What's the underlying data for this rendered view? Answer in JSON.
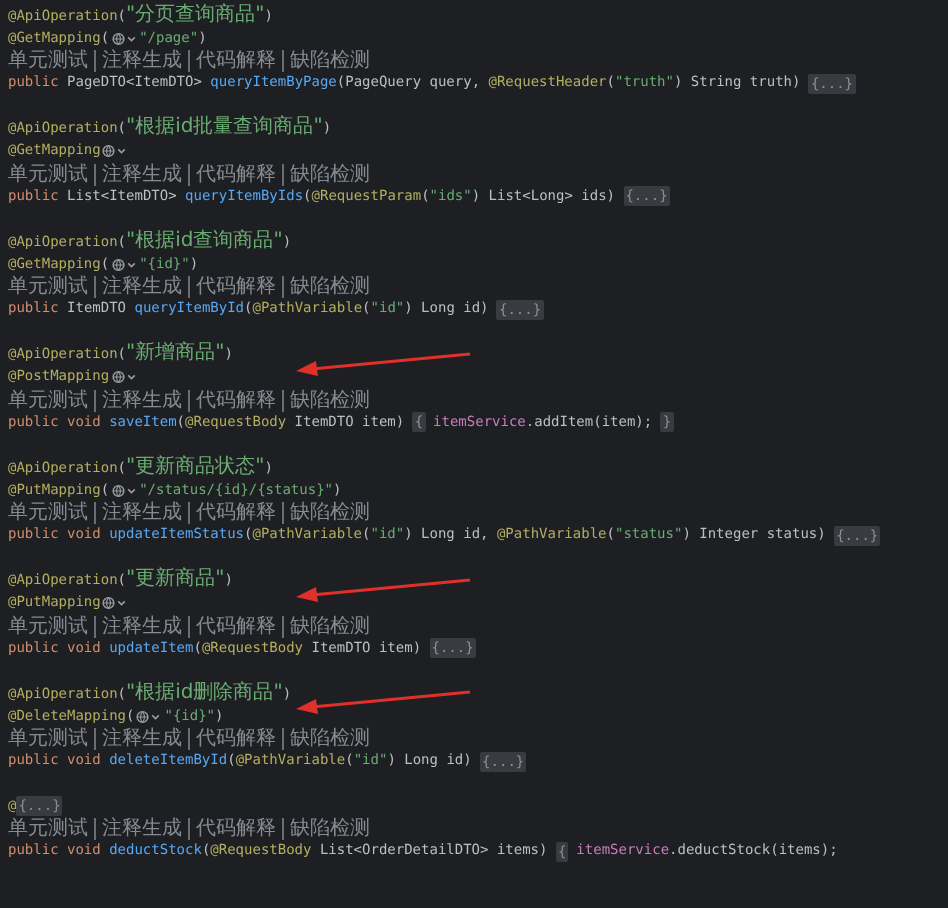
{
  "blocks": [
    {
      "arrow": false,
      "lines": [
        {
          "kind": "code",
          "tokens": [
            {
              "kind": "annotation",
              "text": "@ApiOperation"
            },
            {
              "kind": "plain",
              "text": "("
            },
            {
              "kind": "string",
              "text": "\"分页查询商品\""
            },
            {
              "kind": "plain",
              "text": ")"
            }
          ]
        },
        {
          "kind": "code",
          "tokens": [
            {
              "kind": "annotation",
              "text": "@GetMapping"
            },
            {
              "kind": "plain",
              "text": "("
            },
            {
              "kind": "icon"
            },
            {
              "kind": "string",
              "text": "\"/page\""
            },
            {
              "kind": "plain",
              "text": ")"
            }
          ]
        },
        {
          "kind": "lens",
          "items": [
            "单元测试",
            "注释生成",
            "代码解释",
            "缺陷检测"
          ]
        },
        {
          "kind": "code",
          "tokens": [
            {
              "kind": "keyword",
              "text": "public "
            },
            {
              "kind": "plain",
              "text": "PageDTO<ItemDTO> "
            },
            {
              "kind": "method",
              "text": "queryItemByPage"
            },
            {
              "kind": "plain",
              "text": "(PageQuery query, "
            },
            {
              "kind": "annotation",
              "text": "@RequestHeader"
            },
            {
              "kind": "plain",
              "text": "("
            },
            {
              "kind": "string",
              "text": "\"truth\""
            },
            {
              "kind": "plain",
              "text": ") String truth) "
            },
            {
              "kind": "fold",
              "text": "{...}"
            }
          ]
        }
      ]
    },
    {
      "arrow": false,
      "lines": [
        {
          "kind": "code",
          "tokens": [
            {
              "kind": "annotation",
              "text": "@ApiOperation"
            },
            {
              "kind": "plain",
              "text": "("
            },
            {
              "kind": "string",
              "text": "\"根据id批量查询商品\""
            },
            {
              "kind": "plain",
              "text": ")"
            }
          ]
        },
        {
          "kind": "code",
          "tokens": [
            {
              "kind": "annotation",
              "text": "@GetMapping"
            },
            {
              "kind": "icon"
            }
          ]
        },
        {
          "kind": "lens",
          "items": [
            "单元测试",
            "注释生成",
            "代码解释",
            "缺陷检测"
          ]
        },
        {
          "kind": "code",
          "tokens": [
            {
              "kind": "keyword",
              "text": "public "
            },
            {
              "kind": "plain",
              "text": "List<ItemDTO> "
            },
            {
              "kind": "method",
              "text": "queryItemByIds"
            },
            {
              "kind": "plain",
              "text": "("
            },
            {
              "kind": "annotation",
              "text": "@RequestParam"
            },
            {
              "kind": "plain",
              "text": "("
            },
            {
              "kind": "string",
              "text": "\"ids\""
            },
            {
              "kind": "plain",
              "text": ") List<Long> ids) "
            },
            {
              "kind": "fold",
              "text": "{...}"
            }
          ]
        }
      ]
    },
    {
      "arrow": false,
      "lines": [
        {
          "kind": "code",
          "tokens": [
            {
              "kind": "annotation",
              "text": "@ApiOperation"
            },
            {
              "kind": "plain",
              "text": "("
            },
            {
              "kind": "string",
              "text": "\"根据id查询商品\""
            },
            {
              "kind": "plain",
              "text": ")"
            }
          ]
        },
        {
          "kind": "code",
          "tokens": [
            {
              "kind": "annotation",
              "text": "@GetMapping"
            },
            {
              "kind": "plain",
              "text": "("
            },
            {
              "kind": "icon"
            },
            {
              "kind": "string",
              "text": "\"{id}\""
            },
            {
              "kind": "plain",
              "text": ")"
            }
          ]
        },
        {
          "kind": "lens",
          "items": [
            "单元测试",
            "注释生成",
            "代码解释",
            "缺陷检测"
          ]
        },
        {
          "kind": "code",
          "tokens": [
            {
              "kind": "keyword",
              "text": "public "
            },
            {
              "kind": "plain",
              "text": "ItemDTO "
            },
            {
              "kind": "method",
              "text": "queryItemById"
            },
            {
              "kind": "plain",
              "text": "("
            },
            {
              "kind": "annotation",
              "text": "@PathVariable"
            },
            {
              "kind": "plain",
              "text": "("
            },
            {
              "kind": "string",
              "text": "\"id\""
            },
            {
              "kind": "plain",
              "text": ") Long id) "
            },
            {
              "kind": "fold",
              "text": "{...}"
            }
          ]
        }
      ]
    },
    {
      "arrow": true,
      "lines": [
        {
          "kind": "code",
          "tokens": [
            {
              "kind": "annotation",
              "text": "@ApiOperation"
            },
            {
              "kind": "plain",
              "text": "("
            },
            {
              "kind": "string",
              "text": "\"新增商品\""
            },
            {
              "kind": "plain",
              "text": ")"
            }
          ]
        },
        {
          "kind": "code",
          "tokens": [
            {
              "kind": "annotation",
              "text": "@PostMapping"
            },
            {
              "kind": "icon"
            }
          ]
        },
        {
          "kind": "lens",
          "items": [
            "单元测试",
            "注释生成",
            "代码解释",
            "缺陷检测"
          ]
        },
        {
          "kind": "code",
          "tokens": [
            {
              "kind": "keyword",
              "text": "public void "
            },
            {
              "kind": "method",
              "text": "saveItem"
            },
            {
              "kind": "plain",
              "text": "("
            },
            {
              "kind": "annotation",
              "text": "@RequestBody"
            },
            {
              "kind": "plain",
              "text": " ItemDTO item) "
            },
            {
              "kind": "fold",
              "text": "{"
            },
            {
              "kind": "field",
              "text": "itemService"
            },
            {
              "kind": "plain",
              "text": ".addItem(item); "
            },
            {
              "kind": "fold",
              "text": "}"
            }
          ]
        }
      ]
    },
    {
      "arrow": false,
      "lines": [
        {
          "kind": "code",
          "tokens": [
            {
              "kind": "annotation",
              "text": "@ApiOperation"
            },
            {
              "kind": "plain",
              "text": "("
            },
            {
              "kind": "string",
              "text": "\"更新商品状态\""
            },
            {
              "kind": "plain",
              "text": ")"
            }
          ]
        },
        {
          "kind": "code",
          "tokens": [
            {
              "kind": "annotation",
              "text": "@PutMapping"
            },
            {
              "kind": "plain",
              "text": "("
            },
            {
              "kind": "icon"
            },
            {
              "kind": "string",
              "text": "\"/status/{id}/{status}\""
            },
            {
              "kind": "plain",
              "text": ")"
            }
          ]
        },
        {
          "kind": "lens",
          "items": [
            "单元测试",
            "注释生成",
            "代码解释",
            "缺陷检测"
          ]
        },
        {
          "kind": "code",
          "tokens": [
            {
              "kind": "keyword",
              "text": "public void "
            },
            {
              "kind": "method",
              "text": "updateItemStatus"
            },
            {
              "kind": "plain",
              "text": "("
            },
            {
              "kind": "annotation",
              "text": "@PathVariable"
            },
            {
              "kind": "plain",
              "text": "("
            },
            {
              "kind": "string",
              "text": "\"id\""
            },
            {
              "kind": "plain",
              "text": ") Long id, "
            },
            {
              "kind": "annotation",
              "text": "@PathVariable"
            },
            {
              "kind": "plain",
              "text": "("
            },
            {
              "kind": "string",
              "text": "\"status\""
            },
            {
              "kind": "plain",
              "text": ") Integer status) "
            },
            {
              "kind": "fold",
              "text": "{...}"
            }
          ]
        }
      ]
    },
    {
      "arrow": true,
      "lines": [
        {
          "kind": "code",
          "tokens": [
            {
              "kind": "annotation",
              "text": "@ApiOperation"
            },
            {
              "kind": "plain",
              "text": "("
            },
            {
              "kind": "string",
              "text": "\"更新商品\""
            },
            {
              "kind": "plain",
              "text": ")"
            }
          ]
        },
        {
          "kind": "code",
          "tokens": [
            {
              "kind": "annotation",
              "text": "@PutMapping"
            },
            {
              "kind": "icon"
            }
          ]
        },
        {
          "kind": "lens",
          "items": [
            "单元测试",
            "注释生成",
            "代码解释",
            "缺陷检测"
          ]
        },
        {
          "kind": "code",
          "tokens": [
            {
              "kind": "keyword",
              "text": "public void "
            },
            {
              "kind": "method",
              "text": "updateItem"
            },
            {
              "kind": "plain",
              "text": "("
            },
            {
              "kind": "annotation",
              "text": "@RequestBody"
            },
            {
              "kind": "plain",
              "text": " ItemDTO item) "
            },
            {
              "kind": "fold",
              "text": "{...}"
            }
          ]
        }
      ]
    },
    {
      "arrow": true,
      "lines": [
        {
          "kind": "code",
          "tokens": [
            {
              "kind": "annotation",
              "text": "@ApiOperation"
            },
            {
              "kind": "plain",
              "text": "("
            },
            {
              "kind": "string",
              "text": "\"根据id删除商品\""
            },
            {
              "kind": "plain",
              "text": ")"
            }
          ]
        },
        {
          "kind": "code",
          "tokens": [
            {
              "kind": "annotation",
              "text": "@DeleteMapping"
            },
            {
              "kind": "plain",
              "text": "("
            },
            {
              "kind": "icon"
            },
            {
              "kind": "string",
              "text": "\"{id}\""
            },
            {
              "kind": "plain",
              "text": ")"
            }
          ]
        },
        {
          "kind": "lens",
          "items": [
            "单元测试",
            "注释生成",
            "代码解释",
            "缺陷检测"
          ]
        },
        {
          "kind": "code",
          "tokens": [
            {
              "kind": "keyword",
              "text": "public void "
            },
            {
              "kind": "method",
              "text": "deleteItemById"
            },
            {
              "kind": "plain",
              "text": "("
            },
            {
              "kind": "annotation",
              "text": "@PathVariable"
            },
            {
              "kind": "plain",
              "text": "("
            },
            {
              "kind": "string",
              "text": "\"id\""
            },
            {
              "kind": "plain",
              "text": ") Long id) "
            },
            {
              "kind": "fold",
              "text": "{...}"
            }
          ]
        }
      ]
    },
    {
      "arrow": false,
      "lines": [
        {
          "kind": "code",
          "tokens": [
            {
              "kind": "annotation",
              "text": "@"
            },
            {
              "kind": "fold",
              "text": "{...}"
            }
          ]
        },
        {
          "kind": "lens",
          "items": [
            "单元测试",
            "注释生成",
            "代码解释",
            "缺陷检测"
          ]
        },
        {
          "kind": "code",
          "tokens": [
            {
              "kind": "keyword",
              "text": "public void "
            },
            {
              "kind": "method",
              "text": "deductStock"
            },
            {
              "kind": "plain",
              "text": "("
            },
            {
              "kind": "annotation",
              "text": "@RequestBody"
            },
            {
              "kind": "plain",
              "text": " List<OrderDetailDTO> items) "
            },
            {
              "kind": "fold",
              "text": "{"
            },
            {
              "kind": "field",
              "text": "itemService"
            },
            {
              "kind": "plain",
              "text": ".deductStock(items);"
            }
          ]
        }
      ]
    }
  ]
}
